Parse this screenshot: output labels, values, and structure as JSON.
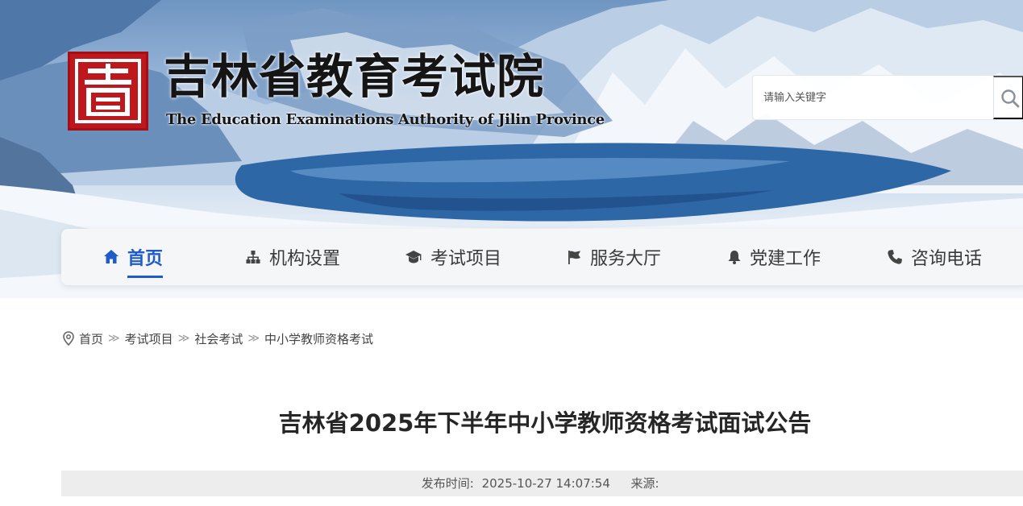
{
  "header": {
    "title_cn": "吉林省教育考试院",
    "title_en": "The Education Examinations Authority of Jilin Province",
    "logo_icon": "red-seal-logo-icon"
  },
  "search": {
    "placeholder": "请输入关键字",
    "value": "",
    "icon": "search-icon"
  },
  "nav": {
    "items": [
      {
        "label": "首页",
        "icon": "home-icon",
        "active": true
      },
      {
        "label": "机构设置",
        "icon": "org-chart-icon",
        "active": false
      },
      {
        "label": "考试项目",
        "icon": "graduation-cap-icon",
        "active": false
      },
      {
        "label": "服务大厅",
        "icon": "flag-icon",
        "active": false
      },
      {
        "label": "党建工作",
        "icon": "bell-icon",
        "active": false
      },
      {
        "label": "咨询电话",
        "icon": "phone-icon",
        "active": false
      }
    ]
  },
  "breadcrumb": {
    "icon": "location-pin-icon",
    "items": [
      "首页",
      "考试项目",
      "社会考试",
      "中小学教师资格考试"
    ],
    "separator": "≫"
  },
  "article": {
    "title": "吉林省2025年下半年中小学教师资格考试面试公告",
    "published_label": "发布时间:",
    "published_value": "2025-10-27 14:07:54",
    "source_label": "来源:",
    "source_value": ""
  },
  "colors": {
    "accent": "#1f5bc9",
    "seal_red": "#c0171c",
    "nav_bg": "#f5f6f8",
    "meta_bg": "#ededed"
  }
}
